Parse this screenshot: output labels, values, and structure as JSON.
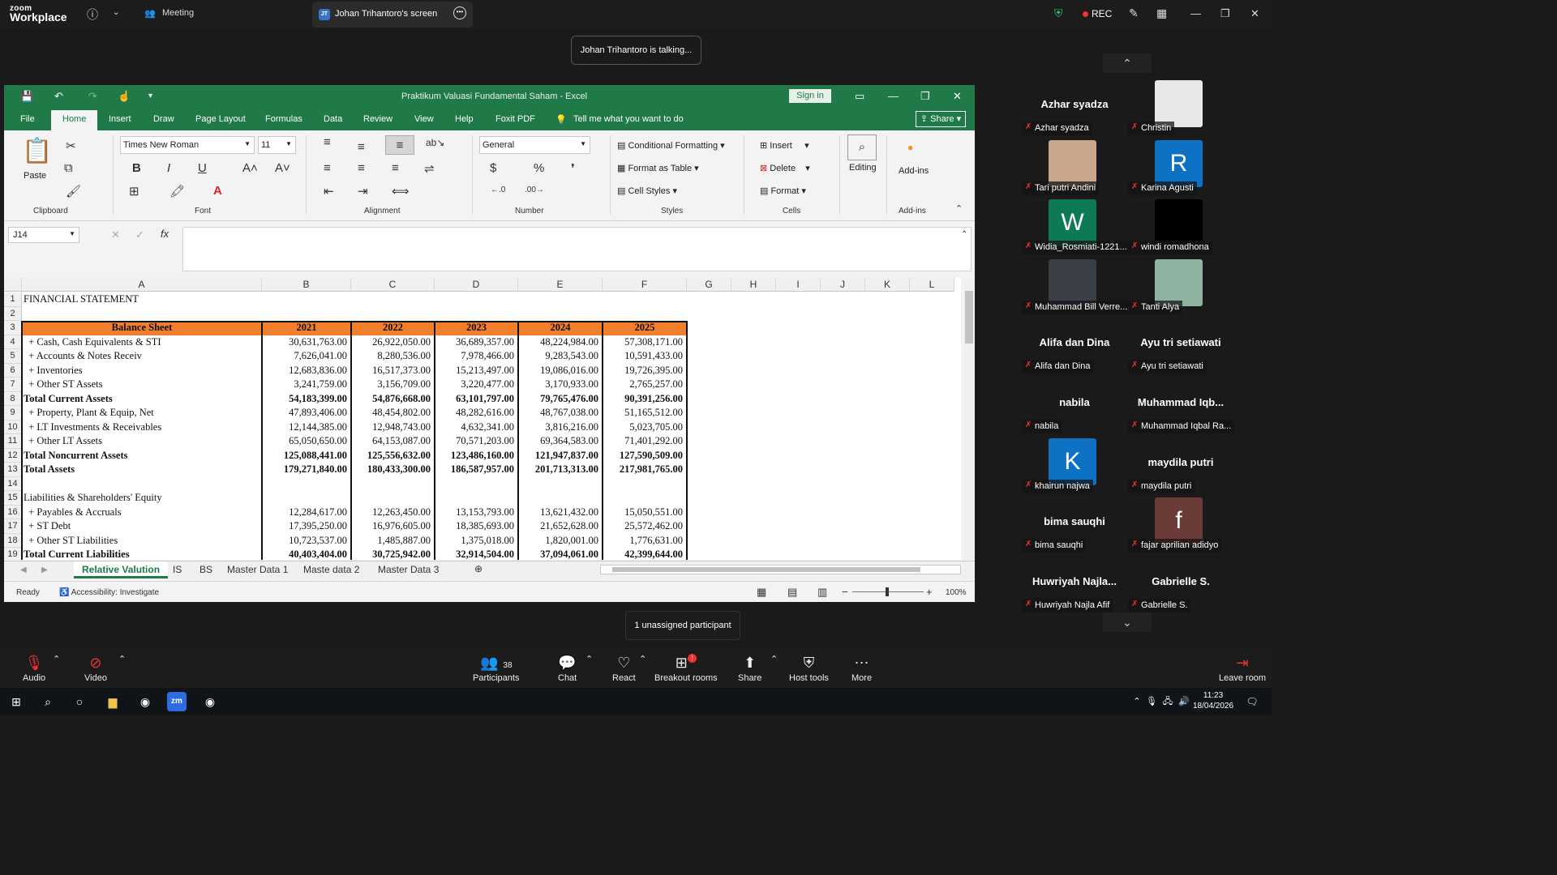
{
  "zoom": {
    "logo_line1": "zoom",
    "logo_line2": "Workplace",
    "meeting_tab": "Meeting",
    "screen_tab_initials": "JT",
    "screen_tab": "Johan Trihantoro's screen",
    "rec_label": "REC",
    "talking": "Johan Trihantoro is talking...",
    "unassigned": "1 unassigned participant",
    "toolbar": {
      "audio": "Audio",
      "video": "Video",
      "participants": "Participants",
      "participants_count": "38",
      "chat": "Chat",
      "react": "React",
      "breakout": "Breakout rooms",
      "breakout_badge": "!",
      "share": "Share",
      "host_tools": "Host tools",
      "more": "More",
      "leave": "Leave room"
    }
  },
  "participants": [
    {
      "big": "Azhar syadza",
      "label": "Azhar syadza"
    },
    {
      "big": "",
      "label": "Christin",
      "avatar": "",
      "avatar_color": "#e8e8e8"
    },
    {
      "big": "",
      "label": "Tari putri Andini",
      "avatar": "",
      "avatar_color": "#c9a58b"
    },
    {
      "big": "",
      "label": "Karina Agusti",
      "avatar": "R",
      "avatar_color": "#0e72c4"
    },
    {
      "big": "",
      "label": "Widia_Rosmiati-1221...",
      "avatar": "W",
      "avatar_color": "#0e7a55"
    },
    {
      "big": "",
      "label": "windi romadhona",
      "avatar": "",
      "avatar_color": "#000000"
    },
    {
      "big": "",
      "label": "Muhammad Bill Verre...",
      "avatar": "",
      "avatar_color": "#3a3f46"
    },
    {
      "big": "",
      "label": "Tanti Alya",
      "avatar": "",
      "avatar_color": "#8fb3a1"
    },
    {
      "big": "Alifa dan Dina",
      "label": "Alifa dan Dina"
    },
    {
      "big": "Ayu tri setiawati",
      "label": "Ayu tri setiawati"
    },
    {
      "big": "nabila",
      "label": "nabila"
    },
    {
      "big": "Muhammad  Iqb...",
      "label": "Muhammad Iqbal Ra..."
    },
    {
      "big": "",
      "label": "khairun najwa",
      "avatar": "K",
      "avatar_color": "#0e72c4"
    },
    {
      "big": "maydila putri",
      "label": "maydila putri"
    },
    {
      "big": "bima sauqhi",
      "label": "bima sauqhi"
    },
    {
      "big": "",
      "label": "fajar aprilian adidyo",
      "avatar": "f",
      "avatar_color": "#6b3b37"
    },
    {
      "big": "Huwriyah  Najla...",
      "label": "Huwriyah Najla Afif"
    },
    {
      "big": "Gabrielle S.",
      "label": "Gabrielle S."
    }
  ],
  "excel": {
    "title": "Praktikum Valuasi Fundamental Saham  -  Excel",
    "sign_in": "Sign in",
    "share": "Share",
    "tabs": [
      "File",
      "Home",
      "Insert",
      "Draw",
      "Page Layout",
      "Formulas",
      "Data",
      "Review",
      "View",
      "Help",
      "Foxit PDF"
    ],
    "tell_me": "Tell me what you want to do",
    "ribbon": {
      "paste": "Paste",
      "clipboard": "Clipboard",
      "font_name": "Times New Roman",
      "font_size": "11",
      "font": "Font",
      "alignment": "Alignment",
      "number_format": "General",
      "number": "Number",
      "conditional": "Conditional Formatting",
      "format_table": "Format as Table",
      "cell_styles": "Cell Styles",
      "styles": "Styles",
      "insert": "Insert",
      "delete": "Delete",
      "format": "Format",
      "cells": "Cells",
      "editing": "Editing",
      "addins": "Add-ins",
      "addins_group": "Add-ins"
    },
    "name_box": "J14",
    "columns": [
      "A",
      "B",
      "C",
      "D",
      "E",
      "F",
      "G",
      "H",
      "I",
      "J",
      "K",
      "L"
    ],
    "header_row": [
      "Balance Sheet",
      "2021",
      "2022",
      "2023",
      "2024",
      "2025"
    ],
    "rows": [
      {
        "n": "1",
        "label": "FINANCIAL STATEMENT",
        "vals": []
      },
      {
        "n": "2",
        "label": "",
        "vals": []
      },
      {
        "n": "3",
        "header": true
      },
      {
        "n": "4",
        "label": "  + Cash, Cash Equivalents & STI",
        "vals": [
          "30,631,763.00",
          "26,922,050.00",
          "36,689,357.00",
          "48,224,984.00",
          "57,308,171.00"
        ]
      },
      {
        "n": "5",
        "label": "  + Accounts & Notes Receiv",
        "vals": [
          "7,626,041.00",
          "8,280,536.00",
          "7,978,466.00",
          "9,283,543.00",
          "10,591,433.00"
        ]
      },
      {
        "n": "6",
        "label": "  + Inventories",
        "vals": [
          "12,683,836.00",
          "16,517,373.00",
          "15,213,497.00",
          "19,086,016.00",
          "19,726,395.00"
        ]
      },
      {
        "n": "7",
        "label": "  + Other ST Assets",
        "vals": [
          "3,241,759.00",
          "3,156,709.00",
          "3,220,477.00",
          "3,170,933.00",
          "2,765,257.00"
        ]
      },
      {
        "n": "8",
        "label": "Total Current Assets",
        "bold": true,
        "vals": [
          "54,183,399.00",
          "54,876,668.00",
          "63,101,797.00",
          "79,765,476.00",
          "90,391,256.00"
        ]
      },
      {
        "n": "9",
        "label": "  + Property, Plant & Equip, Net",
        "vals": [
          "47,893,406.00",
          "48,454,802.00",
          "48,282,616.00",
          "48,767,038.00",
          "51,165,512.00"
        ]
      },
      {
        "n": "10",
        "label": "  + LT Investments & Receivables",
        "vals": [
          "12,144,385.00",
          "12,948,743.00",
          "4,632,341.00",
          "3,816,216.00",
          "5,023,705.00"
        ]
      },
      {
        "n": "11",
        "label": "  + Other LT Assets",
        "vals": [
          "65,050,650.00",
          "64,153,087.00",
          "70,571,203.00",
          "69,364,583.00",
          "71,401,292.00"
        ]
      },
      {
        "n": "12",
        "label": "Total Noncurrent Assets",
        "bold": true,
        "vals": [
          "125,088,441.00",
          "125,556,632.00",
          "123,486,160.00",
          "121,947,837.00",
          "127,590,509.00"
        ]
      },
      {
        "n": "13",
        "label": "Total Assets",
        "bold": true,
        "vals": [
          "179,271,840.00",
          "180,433,300.00",
          "186,587,957.00",
          "201,713,313.00",
          "217,981,765.00"
        ]
      },
      {
        "n": "14",
        "label": "",
        "vals": []
      },
      {
        "n": "15",
        "label": "Liabilities & Shareholders' Equity",
        "vals": []
      },
      {
        "n": "16",
        "label": "  + Payables & Accruals",
        "vals": [
          "12,284,617.00",
          "12,263,450.00",
          "13,153,793.00",
          "13,621,432.00",
          "15,050,551.00"
        ]
      },
      {
        "n": "17",
        "label": "  + ST Debt",
        "vals": [
          "17,395,250.00",
          "16,976,605.00",
          "18,385,693.00",
          "21,652,628.00",
          "25,572,462.00"
        ]
      },
      {
        "n": "18",
        "label": "  + Other ST Liabilities",
        "vals": [
          "10,723,537.00",
          "1,485,887.00",
          "1,375,018.00",
          "1,820,001.00",
          "1,776,631.00"
        ]
      },
      {
        "n": "19",
        "label": "Total Current Liabilities",
        "bold": true,
        "vals": [
          "40,403,404.00",
          "30,725,942.00",
          "32,914,504.00",
          "37,094,061.00",
          "42,399,644.00"
        ]
      }
    ],
    "sheet_tabs": [
      "Relative Valution",
      "IS",
      "BS",
      "Master Data 1",
      "Maste data 2",
      "Master Data 3"
    ],
    "status": "Ready",
    "accessibility": "Accessibility: Investigate",
    "zoom": "100%"
  },
  "taskbar": {
    "time": "11:23",
    "date": "18/04/2026"
  }
}
